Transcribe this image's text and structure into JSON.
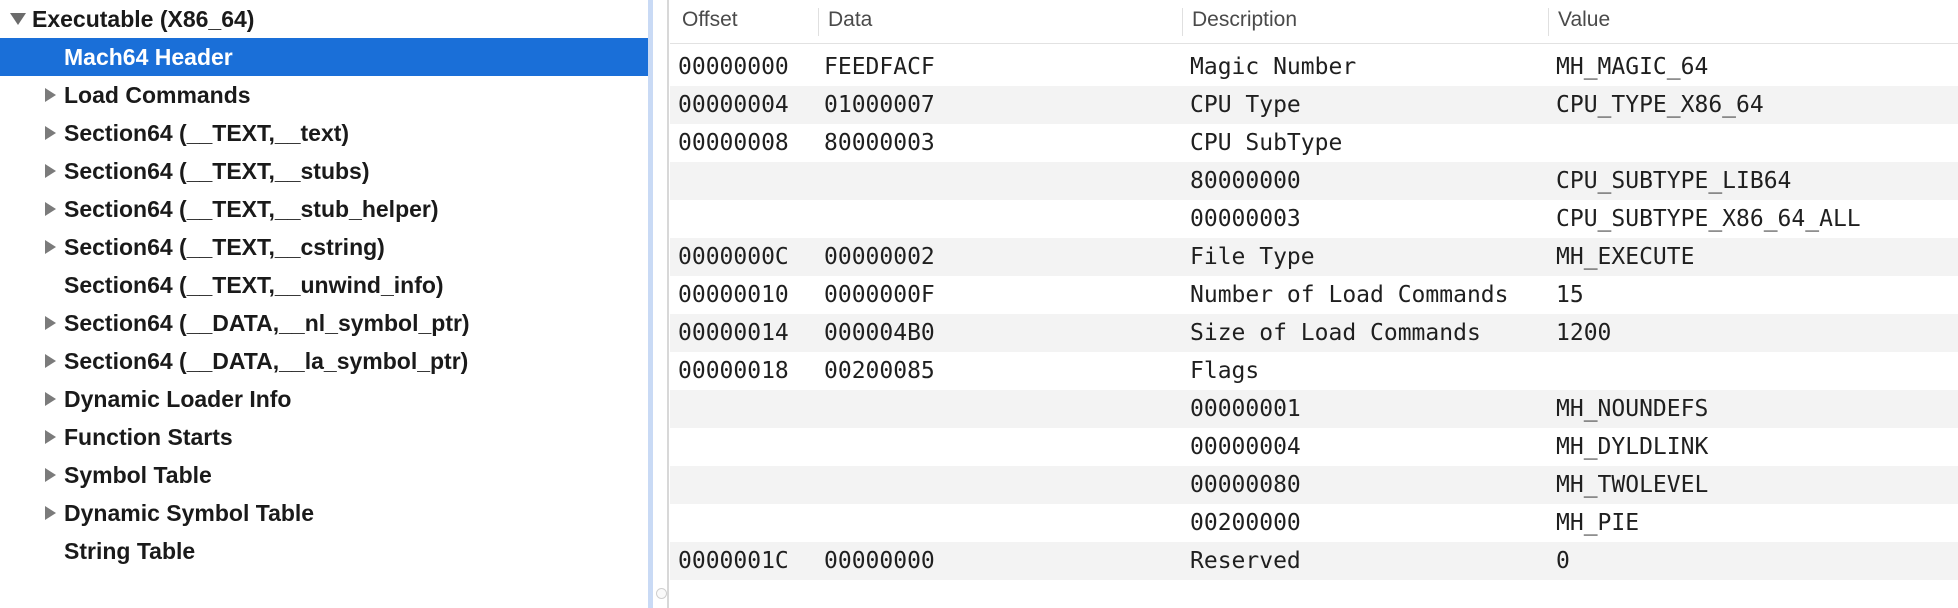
{
  "tree": {
    "root": {
      "label": "Executable  (X86_64)",
      "expanded": true
    },
    "items": [
      {
        "label": "Mach64 Header",
        "has_children": false,
        "selected": true
      },
      {
        "label": "Load Commands",
        "has_children": true
      },
      {
        "label": "Section64 (__TEXT,__text)",
        "has_children": true
      },
      {
        "label": "Section64 (__TEXT,__stubs)",
        "has_children": true
      },
      {
        "label": "Section64 (__TEXT,__stub_helper)",
        "has_children": true
      },
      {
        "label": "Section64 (__TEXT,__cstring)",
        "has_children": true
      },
      {
        "label": "Section64 (__TEXT,__unwind_info)",
        "has_children": false
      },
      {
        "label": "Section64 (__DATA,__nl_symbol_ptr)",
        "has_children": true
      },
      {
        "label": "Section64 (__DATA,__la_symbol_ptr)",
        "has_children": true
      },
      {
        "label": "Dynamic Loader Info",
        "has_children": true
      },
      {
        "label": "Function Starts",
        "has_children": true
      },
      {
        "label": "Symbol Table",
        "has_children": true
      },
      {
        "label": "Dynamic Symbol Table",
        "has_children": true
      },
      {
        "label": "String Table",
        "has_children": false
      }
    ]
  },
  "table": {
    "columns": {
      "offset": "Offset",
      "data": "Data",
      "description": "Description",
      "value": "Value"
    },
    "rows": [
      {
        "offset": "00000000",
        "data": "FEEDFACF",
        "description": "Magic Number",
        "value": "MH_MAGIC_64"
      },
      {
        "offset": "00000004",
        "data": "01000007",
        "description": "CPU Type",
        "value": "CPU_TYPE_X86_64"
      },
      {
        "offset": "00000008",
        "data": "80000003",
        "description": "CPU SubType",
        "value": ""
      },
      {
        "offset": "",
        "data": "",
        "description": "80000000",
        "value": "CPU_SUBTYPE_LIB64"
      },
      {
        "offset": "",
        "data": "",
        "description": "00000003",
        "value": "CPU_SUBTYPE_X86_64_ALL"
      },
      {
        "offset": "0000000C",
        "data": "00000002",
        "description": "File Type",
        "value": "MH_EXECUTE"
      },
      {
        "offset": "00000010",
        "data": "0000000F",
        "description": "Number of Load Commands",
        "value": "15"
      },
      {
        "offset": "00000014",
        "data": "000004B0",
        "description": "Size of Load Commands",
        "value": "1200"
      },
      {
        "offset": "00000018",
        "data": "00200085",
        "description": "Flags",
        "value": ""
      },
      {
        "offset": "",
        "data": "",
        "description": "00000001",
        "value": "MH_NOUNDEFS"
      },
      {
        "offset": "",
        "data": "",
        "description": "00000004",
        "value": "MH_DYLDLINK"
      },
      {
        "offset": "",
        "data": "",
        "description": "00000080",
        "value": "MH_TWOLEVEL"
      },
      {
        "offset": "",
        "data": "",
        "description": "00200000",
        "value": "MH_PIE"
      },
      {
        "offset": "0000001C",
        "data": "00000000",
        "description": "Reserved",
        "value": "0"
      }
    ]
  },
  "colors": {
    "selection": "#1a6fd8",
    "alt_row": "#f3f3f3",
    "splitter_highlight": "#c9daf5"
  },
  "icons": {
    "collapsed": "disclosure-triangle-right-icon",
    "expanded": "disclosure-triangle-down-icon"
  }
}
